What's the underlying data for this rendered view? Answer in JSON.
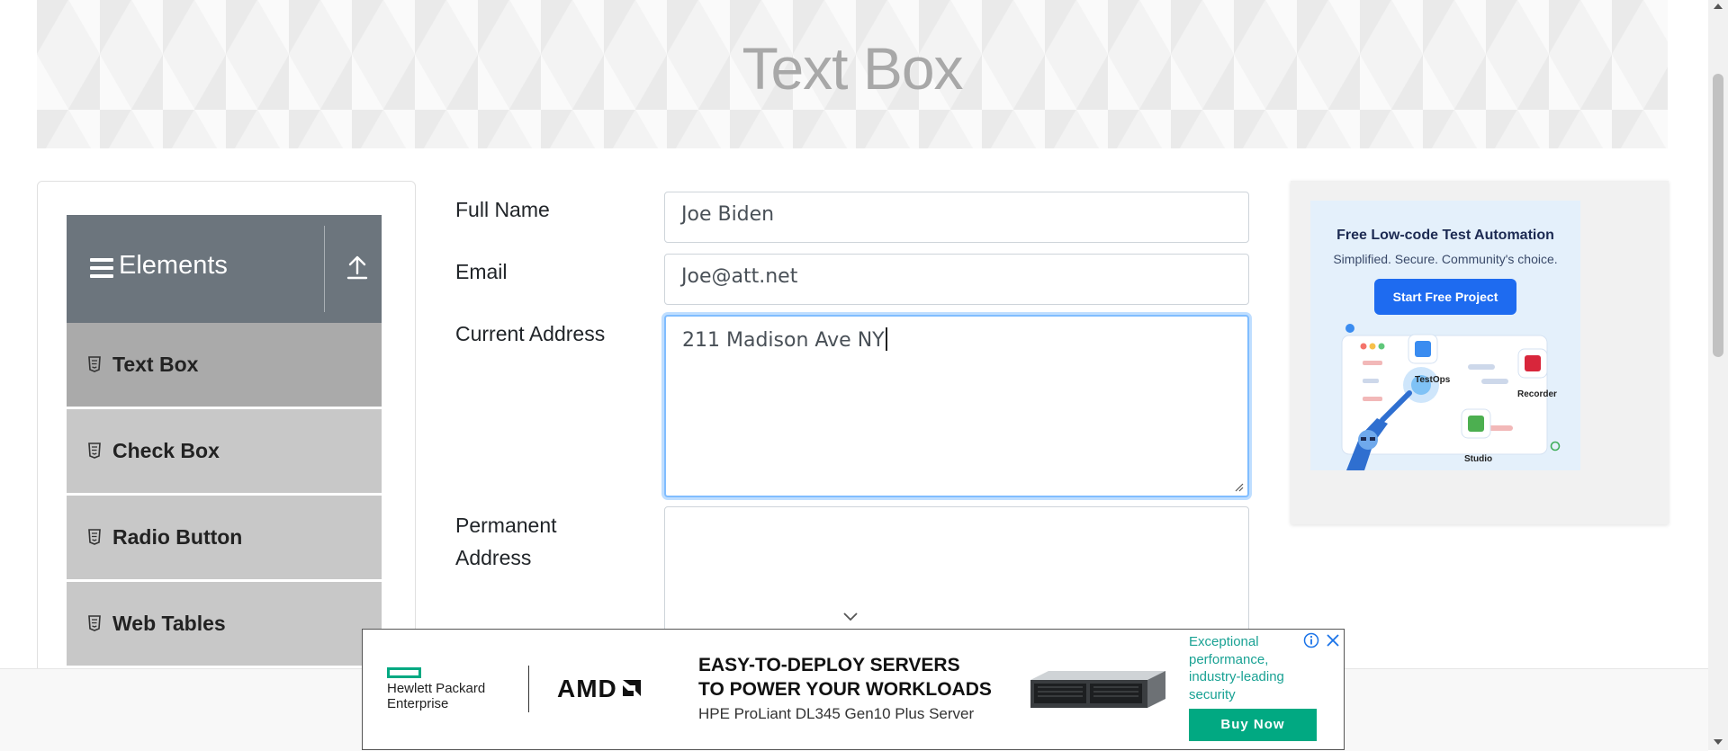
{
  "page": {
    "title": "Text Box"
  },
  "sidebar": {
    "group_title": "Elements",
    "items": [
      {
        "label": "Text Box",
        "active": true
      },
      {
        "label": "Check Box",
        "active": false
      },
      {
        "label": "Radio Button",
        "active": false
      },
      {
        "label": "Web Tables",
        "active": false
      }
    ]
  },
  "form": {
    "full_name": {
      "label": "Full Name",
      "value": "Joe Biden"
    },
    "email": {
      "label": "Email",
      "value": "Joe@att.net"
    },
    "current_address": {
      "label": "Current Address",
      "value": "211 Madison Ave NY"
    },
    "permanent_address": {
      "label_line1": "Permanent",
      "label_line2": "Address",
      "value": ""
    }
  },
  "side_ad": {
    "headline": "Free Low-code Test Automation",
    "subtitle": "Simplified. Secure. Community's choice.",
    "cta_label": "Start Free Project",
    "products": [
      "TestOps",
      "Recorder",
      "Studio"
    ]
  },
  "bottom_ad": {
    "brand1_line1": "Hewlett Packard",
    "brand1_line2": "Enterprise",
    "brand2": "AMD",
    "headline_line1": "EASY-TO-DEPLOY SERVERS",
    "headline_line2": "TO POWER YOUR WORKLOADS",
    "subline": "HPE ProLiant DL345 Gen10 Plus Server",
    "blurb": "Exceptional performance, industry-leading security",
    "cta_label": "Buy Now"
  },
  "colors": {
    "sidebar_header": "#6c757d",
    "sidebar_item_active": "#aaaaaa",
    "sidebar_item": "#c8c8c8",
    "focus_border": "#80bdff",
    "side_ad_cta": "#1e6bf0",
    "hpe_green": "#01a982"
  }
}
